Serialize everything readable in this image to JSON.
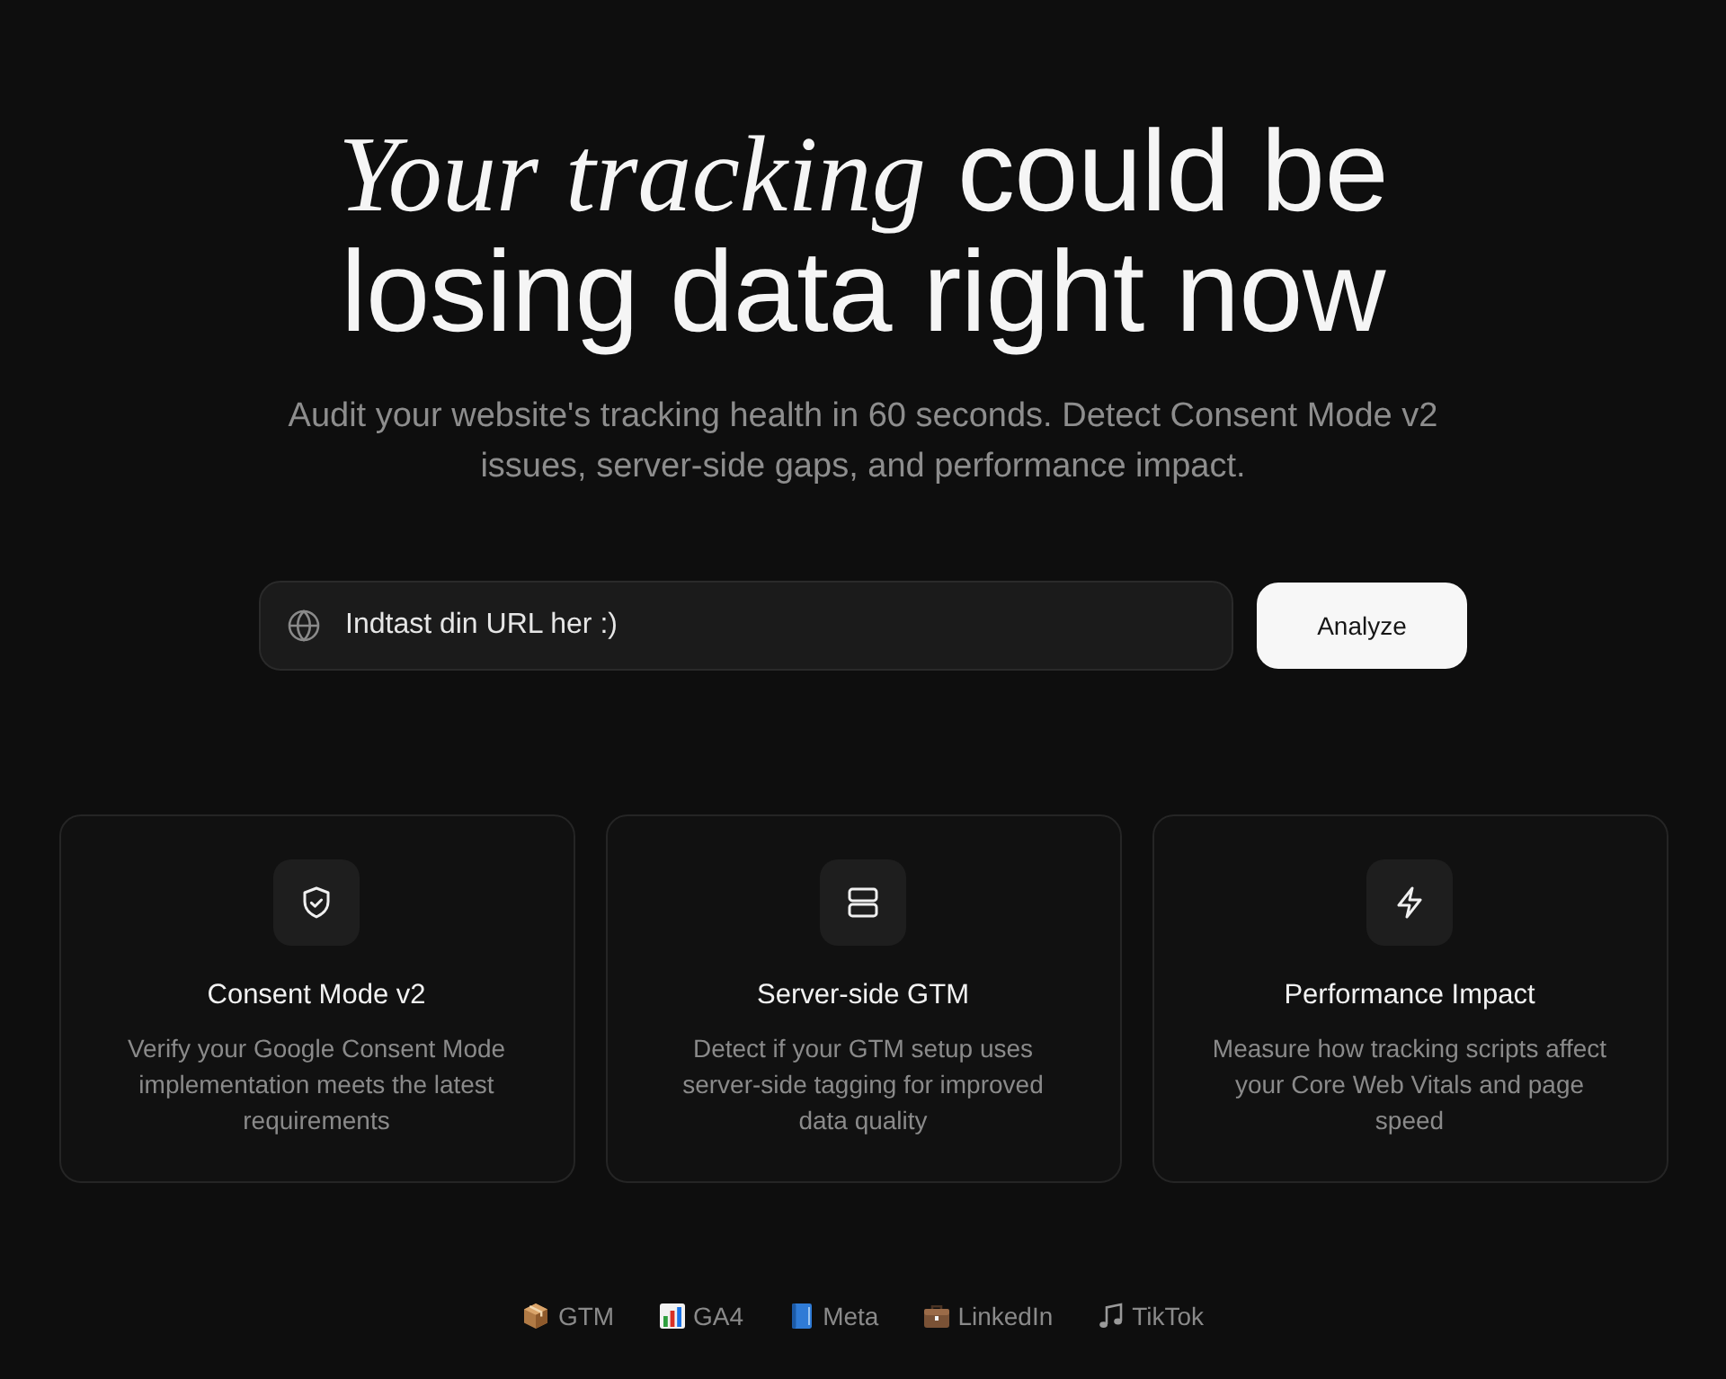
{
  "hero": {
    "headline": "*Your tracking* could be losing data right now",
    "subtitle": "Audit your website's tracking health in 60 seconds. Detect Consent Mode v2 issues, server-side gaps, and performance impact."
  },
  "url_form": {
    "placeholder": "Indtast din URL her :)",
    "button": "Analyze"
  },
  "features": [
    {
      "title": "Consent Mode v2",
      "description": "Verify your Google Consent Mode implementation meets the latest requirements"
    },
    {
      "title": "Server-side GTM",
      "description": "Detect if your GTM setup uses server-side tagging for improved data quality"
    },
    {
      "title": "Performance Impact",
      "description": "Measure how tracking scripts affect your Core Web Vitals and page speed"
    }
  ],
  "platforms": [
    {
      "label": "GTM"
    },
    {
      "label": "GA4"
    },
    {
      "label": "Meta"
    },
    {
      "label": "LinkedIn"
    },
    {
      "label": "TikTok"
    }
  ]
}
